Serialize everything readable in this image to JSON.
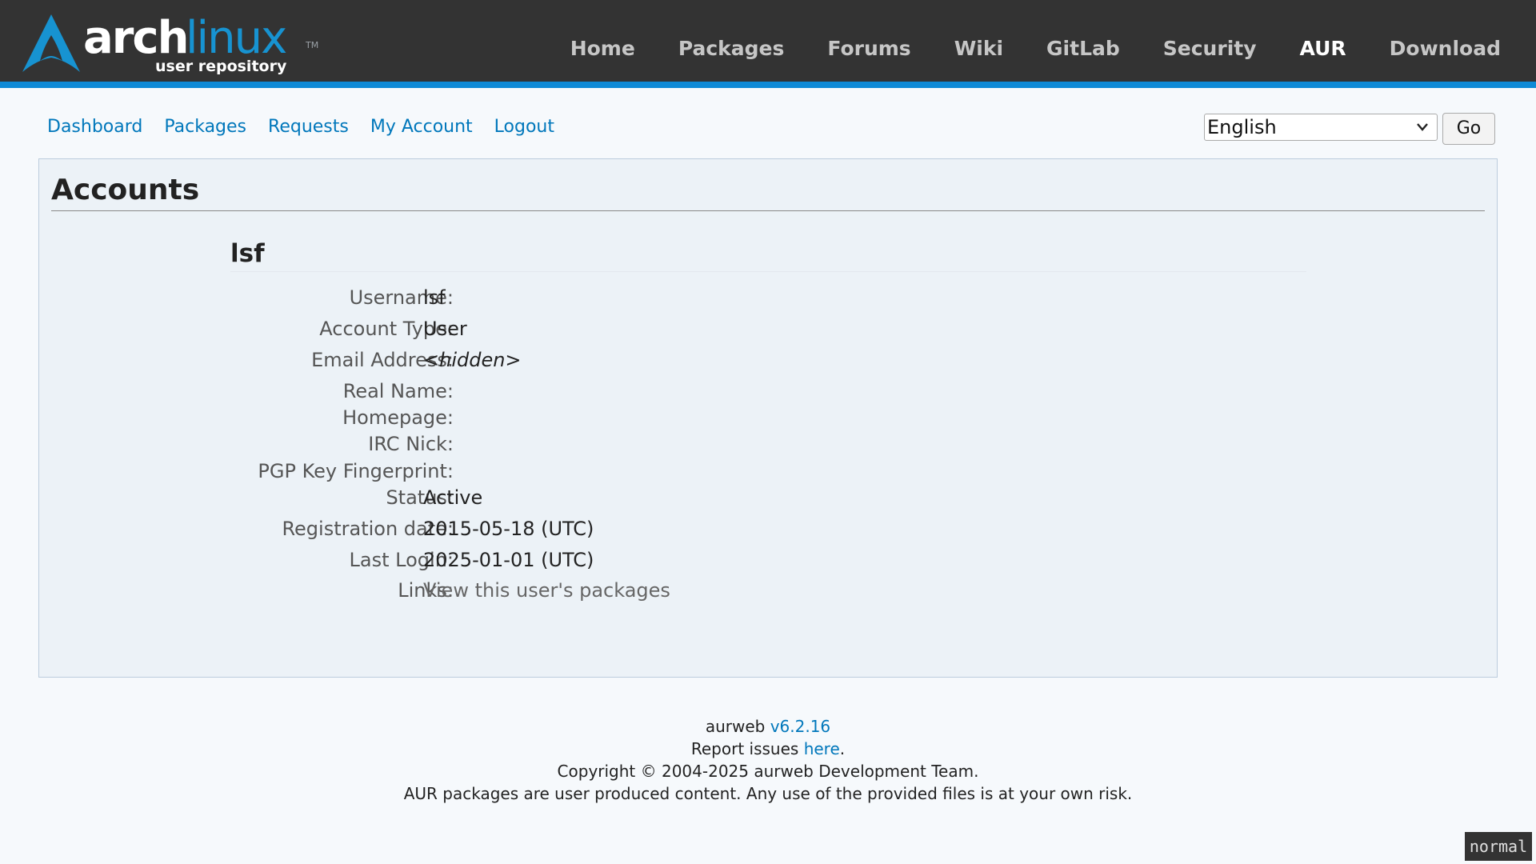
{
  "brand": {
    "arch": "arch",
    "linux": "linux",
    "tm": "TM",
    "subtitle": "user repository",
    "accent": "#1793d1"
  },
  "topnav": {
    "items": [
      "Home",
      "Packages",
      "Forums",
      "Wiki",
      "GitLab",
      "Security",
      "AUR",
      "Download"
    ],
    "active": "AUR"
  },
  "subnav": {
    "items": [
      "Dashboard",
      "Packages",
      "Requests",
      "My Account",
      "Logout"
    ]
  },
  "language": {
    "selected": "English",
    "go_label": "Go"
  },
  "page": {
    "title": "Accounts",
    "user_heading": "lsf"
  },
  "account": {
    "fields": [
      {
        "label": "Username:",
        "value": "lsf"
      },
      {
        "label": "Account Type:",
        "value": "User"
      },
      {
        "label": "Email Address:",
        "value": "<hidden>"
      },
      {
        "label": "Real Name:",
        "value": ""
      },
      {
        "label": "Homepage:",
        "value": ""
      },
      {
        "label": "IRC Nick:",
        "value": ""
      },
      {
        "label": "PGP Key Fingerprint:",
        "value": ""
      },
      {
        "label": "Status:",
        "value": "Active"
      },
      {
        "label": "Registration date:",
        "value": "2015-05-18 (UTC)"
      },
      {
        "label": "Last Login:",
        "value": "2025-01-01 (UTC)"
      },
      {
        "label": "Links:",
        "value": "View this user's packages"
      }
    ]
  },
  "footer": {
    "line1_prefix": "aurweb ",
    "version": "v6.2.16",
    "line2_prefix": "Report issues ",
    "line2_link": "here",
    "line2_suffix": ".",
    "copyright": "Copyright © 2004-2025 aurweb Development Team.",
    "disclaimer": "AUR packages are user produced content. Any use of the provided files is at your own risk."
  },
  "mode_indicator": "normal"
}
